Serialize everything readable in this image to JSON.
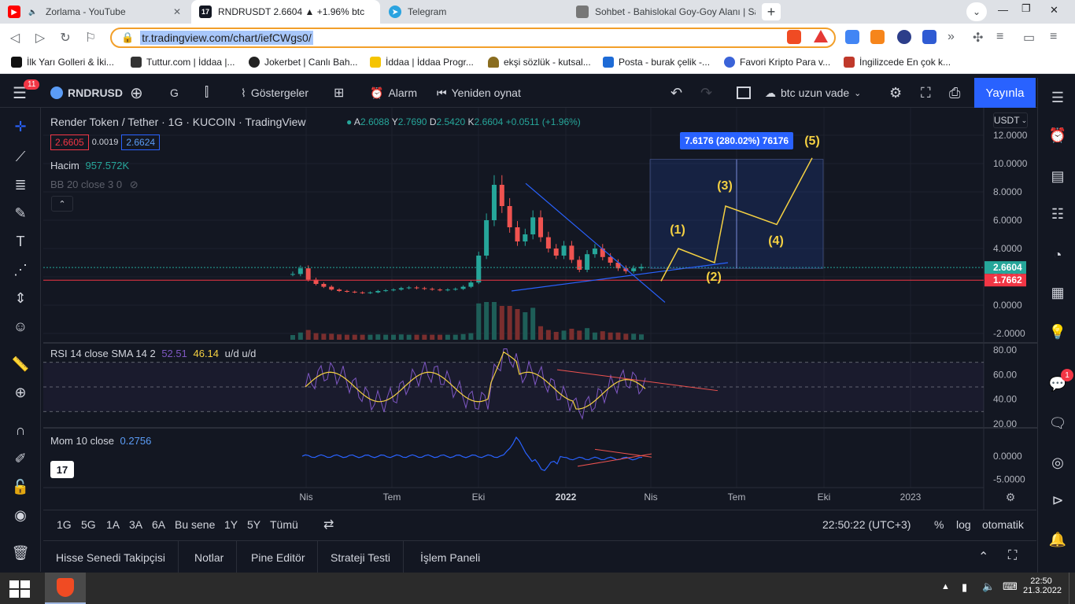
{
  "browser": {
    "tabs": [
      {
        "title": "Zorlama - YouTube",
        "icon": "youtube-icon",
        "color": "#ff0000"
      },
      {
        "title": "RNDRUSDT 2.6604 ▲ +1.96% btc",
        "icon": "tradingview-icon",
        "color": "#131722"
      },
      {
        "title": "Telegram",
        "icon": "telegram-icon",
        "color": "#2aa3e0"
      },
      {
        "title": "Sohbet - Bahislokal Goy-Goy Alanı | Sa",
        "icon": "page-icon",
        "color": "#777777"
      }
    ],
    "url": "tr.tradingview.com/chart/iefCWgs0/",
    "bookmarks": [
      "İlk Yarı Golleri & İki...",
      "Tuttur.com | İddaa |...",
      "Jokerbet | Canlı Bah...",
      "İddaa | İddaa Progr...",
      "ekşi sözlük - kutsal...",
      "Posta - burak çelik -...",
      "Favori Kripto Para v...",
      "İngilizcede En çok k..."
    ]
  },
  "toolbar": {
    "notif_count": "11",
    "symbol": "RNDRUSD",
    "interval": "G",
    "indicators": "Göstergeler",
    "alert": "Alarm",
    "replay": "Yeniden oynat",
    "layout_name": "btc uzun vade",
    "publish": "Yayınla"
  },
  "legend": {
    "title": "Render Token / Tether · 1G · KUCOIN · TradingView",
    "ohlc": [
      {
        "k": "A",
        "v": "2.6088"
      },
      {
        "k": "Y",
        "v": "2.7690"
      },
      {
        "k": "D",
        "v": "2.5420"
      },
      {
        "k": "K",
        "v": "2.6604"
      },
      {
        "k": "",
        "v": "+0.0511 (+1.96%)"
      }
    ],
    "bid": "2.6605",
    "spread": "0.0019",
    "ask": "2.6624",
    "volume_label": "Hacim",
    "volume_value": "957.572K",
    "bb": "BB 20 close 3 0",
    "rsi_label": "RSI 14 close SMA 14 2",
    "rsi_v1": "52.51",
    "rsi_v2": "46.14",
    "rsi_extra": "u/d u/d",
    "mom_label": "Mom 10 close",
    "mom_value": "0.2756"
  },
  "chart_data": {
    "type": "candlestick",
    "title": "Render Token / Tether · 1G · KUCOIN · TradingView",
    "currency": "USDT",
    "y_ticks": [
      "12.0000",
      "10.0000",
      "8.0000",
      "6.0000",
      "4.0000",
      "2.0000",
      "0.0000",
      "-2.0000"
    ],
    "ylim": [
      -2.4,
      13
    ],
    "x_ticks": [
      "Nis",
      "Tem",
      "Eki",
      "2022",
      "Nis",
      "Tem",
      "Eki",
      "2023"
    ],
    "price_line": {
      "value": 2.6604,
      "label": "2.6604",
      "color": "#26a69a"
    },
    "support_line": {
      "value": 1.7662,
      "label": "1.7662",
      "color": "#f23645"
    },
    "measure_label": "7.6176 (280.02%) 76176",
    "wave_labels": [
      "(1)",
      "(2)",
      "(3)",
      "(4)",
      "(5)"
    ],
    "price_series": [
      2.2,
      2.6,
      1.8,
      1.5,
      1.3,
      1.1,
      1.0,
      0.95,
      0.9,
      0.85,
      0.9,
      1.0,
      1.05,
      1.1,
      1.2,
      1.25,
      1.2,
      1.15,
      1.1,
      1.05,
      1.1,
      1.15,
      1.3,
      1.6,
      3.5,
      6.0,
      8.5,
      7.0,
      5.5,
      4.5,
      5.0,
      6.2,
      4.8,
      4.0,
      3.5,
      4.2,
      3.2,
      2.5,
      3.6,
      4.0,
      3.4,
      3.0,
      2.6,
      2.4,
      2.6,
      2.7
    ],
    "rsi": {
      "ticks": [
        "80.00",
        "60.00",
        "40.00",
        "20.00"
      ],
      "ylim": [
        18,
        82
      ]
    },
    "momentum": {
      "ticks": [
        "0.0000",
        "-5.0000"
      ]
    }
  },
  "bottom": {
    "ranges": [
      "1G",
      "5G",
      "1A",
      "3A",
      "6A",
      "Bu sene",
      "1Y",
      "5Y",
      "Tümü"
    ],
    "time": "22:50:22 (UTC+3)",
    "percent": "%",
    "log": "log",
    "auto": "otomatik"
  },
  "panels": [
    "Hisse Senedi Takipçisi",
    "Notlar",
    "Pine Editör",
    "Strateji Testi",
    "İşlem Paneli"
  ],
  "right_badge": "1",
  "taskbar": {
    "time": "22:50",
    "date": "21.3.2022"
  }
}
